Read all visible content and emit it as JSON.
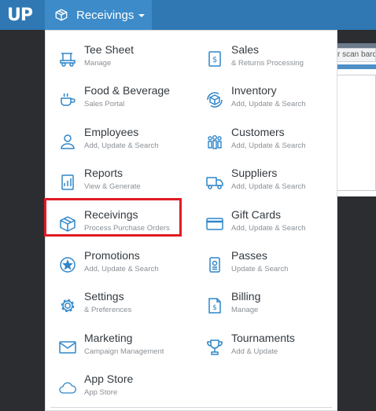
{
  "header": {
    "logo_text": "UP",
    "nav_label": "Receivings",
    "nav_icon": "box-icon"
  },
  "background": {
    "search_placeholder": "r scan barc"
  },
  "menu": {
    "accent_color": "#2f86c9",
    "highlighted_item": "Receivings",
    "items": [
      {
        "label": "Tee Sheet",
        "sub": "Manage",
        "icon": "golf-cart-icon"
      },
      {
        "label": "Sales",
        "sub": "& Returns Processing",
        "icon": "sales-icon"
      },
      {
        "label": "Food & Beverage",
        "sub": "Sales Portal",
        "icon": "coffee-cup-icon"
      },
      {
        "label": "Inventory",
        "sub": "Add, Update & Search",
        "icon": "inventory-icon"
      },
      {
        "label": "Employees",
        "sub": "Add, Update & Search",
        "icon": "employee-icon"
      },
      {
        "label": "Customers",
        "sub": "Add, Update & Search",
        "icon": "customers-icon"
      },
      {
        "label": "Reports",
        "sub": "View & Generate",
        "icon": "reports-icon"
      },
      {
        "label": "Suppliers",
        "sub": "Add, Update & Search",
        "icon": "truck-icon"
      },
      {
        "label": "Receivings",
        "sub": "Process Purchase Orders",
        "icon": "box-icon"
      },
      {
        "label": "Gift Cards",
        "sub": "Add, Update & Search",
        "icon": "gift-card-icon"
      },
      {
        "label": "Promotions",
        "sub": "Add, Update & Search",
        "icon": "star-badge-icon"
      },
      {
        "label": "Passes",
        "sub": "Update & Search",
        "icon": "pass-icon"
      },
      {
        "label": "Settings",
        "sub": "& Preferences",
        "icon": "gear-icon"
      },
      {
        "label": "Billing",
        "sub": "Manage",
        "icon": "billing-icon"
      },
      {
        "label": "Marketing",
        "sub": "Campaign Management",
        "icon": "envelope-icon"
      },
      {
        "label": "Tournaments",
        "sub": "Add & Update",
        "icon": "trophy-icon"
      },
      {
        "label": "App Store",
        "sub": "App Store",
        "icon": "cloud-icon"
      }
    ]
  }
}
